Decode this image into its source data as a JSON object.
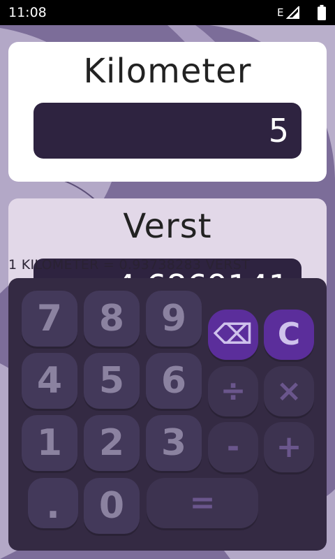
{
  "status_bar": {
    "time": "11:08",
    "network": "E"
  },
  "from": {
    "unit": "Kilometer",
    "value": "5"
  },
  "to": {
    "unit": "Verst",
    "value": "4.6869141"
  },
  "rate_text": "1 KILOMETER = 0.93738283 VERST",
  "keypad": {
    "digits": [
      "7",
      "8",
      "9",
      "4",
      "5",
      "6",
      "1",
      "2",
      "3",
      ".",
      "0"
    ],
    "backspace": "⌫",
    "clear": "C",
    "divide": "÷",
    "multiply": "×",
    "minus": "-",
    "plus": "+",
    "equals": "="
  },
  "colors": {
    "accent": "#5b2e9b",
    "field": "#2e2340",
    "keypad": "#342a43",
    "key": "#43395a"
  }
}
